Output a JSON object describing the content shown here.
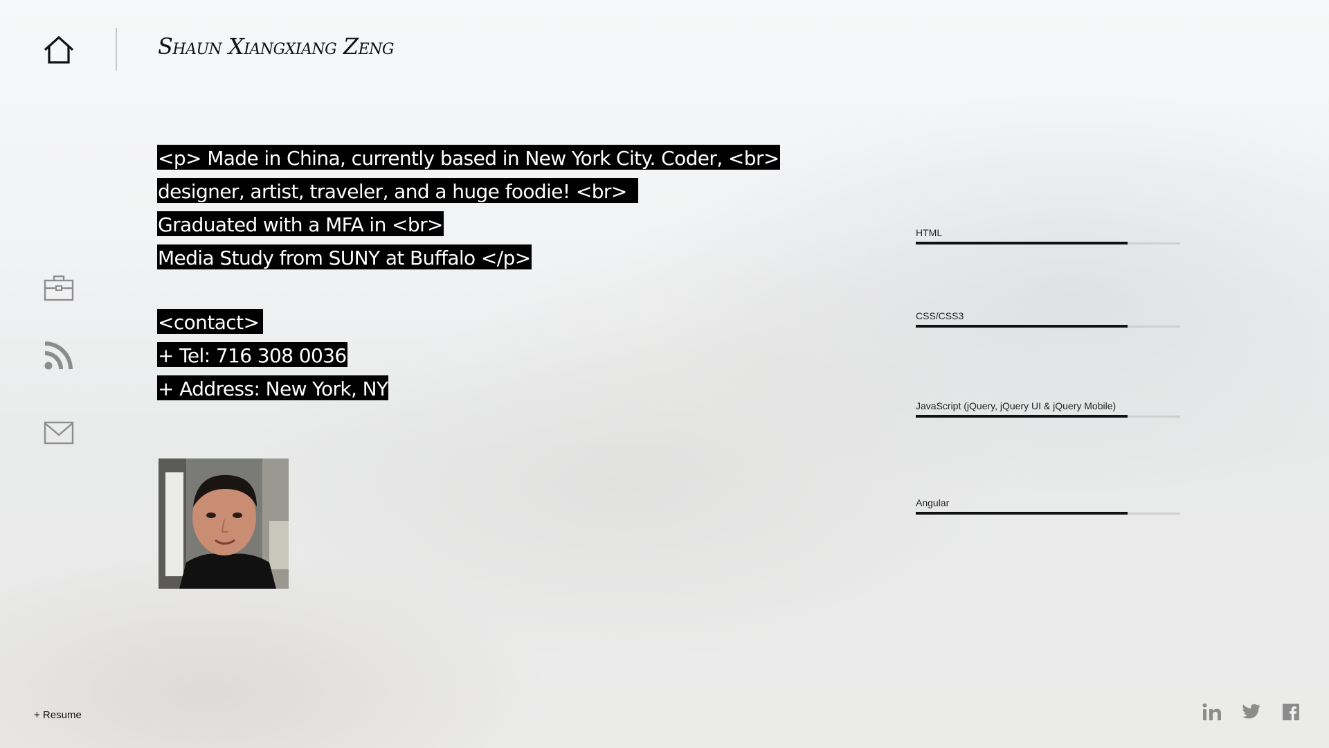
{
  "header": {
    "title": "Shaun Xiangxiang Zeng"
  },
  "nav": {
    "items": [
      {
        "name": "home",
        "icon": "home-icon"
      },
      {
        "name": "portfolio",
        "icon": "briefcase-icon"
      },
      {
        "name": "blog",
        "icon": "rss-icon"
      },
      {
        "name": "contact",
        "icon": "mail-icon"
      }
    ]
  },
  "bio": {
    "lines": [
      "<p> Made in China, currently based in New York City. Coder, <br>",
      "designer, artist, traveler, and a huge foodie! <br> ",
      "Graduated with a MFA in <br>",
      "Media Study from SUNY at Buffalo </p>"
    ],
    "contact_heading": "<contact>",
    "tel": "+ Tel: 716 308 0036",
    "address": "+ Address: New York, NY"
  },
  "skills": [
    {
      "label": "HTML",
      "level": 0.8
    },
    {
      "label": "CSS/CSS3",
      "level": 0.8
    },
    {
      "label": "JavaScript (jQuery, jQuery UI & jQuery Mobile)",
      "level": 0.8
    },
    {
      "label": "Angular",
      "level": 0.8
    }
  ],
  "footer": {
    "resume_label": "+ Resume",
    "social": [
      "linkedin-icon",
      "twitter-icon",
      "facebook-icon"
    ]
  },
  "colors": {
    "highlight_bg": "#000000",
    "highlight_text": "#ffffff",
    "icon_gray": "#8c8c8c"
  }
}
